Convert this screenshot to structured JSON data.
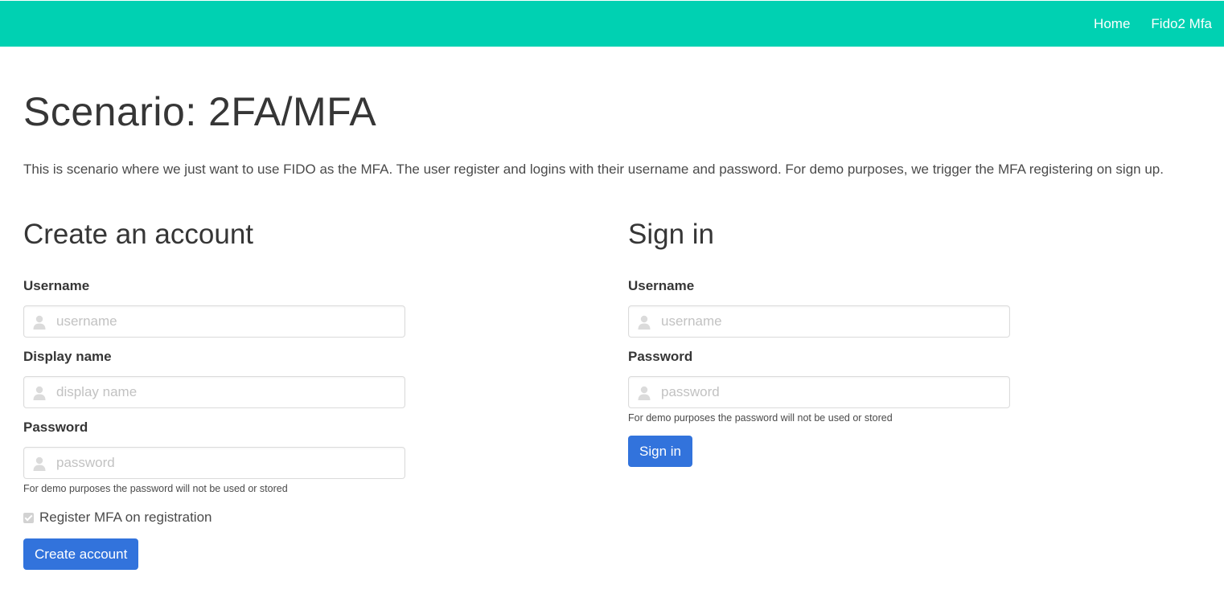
{
  "navbar": {
    "color": "#00d1b2",
    "links": [
      "Home",
      "Fido2 Mfa"
    ]
  },
  "page": {
    "title": "Scenario: 2FA/MFA",
    "intro": "This is scenario where we just want to use FIDO as the MFA. The user register and logins with their username and password. For demo purposes, we trigger the MFA registering on sign up."
  },
  "register": {
    "title": "Create an account",
    "username_label": "Username",
    "username_placeholder": "username",
    "displayname_label": "Display name",
    "displayname_placeholder": "display name",
    "password_label": "Password",
    "password_placeholder": "password",
    "password_help": "For demo purposes the password will not be used or stored",
    "mfa_checkbox_label": "Register MFA on registration",
    "mfa_checked": true,
    "submit_label": "Create account"
  },
  "signin": {
    "title": "Sign in",
    "username_label": "Username",
    "username_placeholder": "username",
    "password_label": "Password",
    "password_placeholder": "password",
    "password_help": "For demo purposes the password will not be used or stored",
    "submit_label": "Sign in"
  },
  "icons": {
    "input_icon": "user-icon"
  },
  "colors": {
    "primary_button": "#3273dc",
    "navbar": "#00d1b2"
  }
}
